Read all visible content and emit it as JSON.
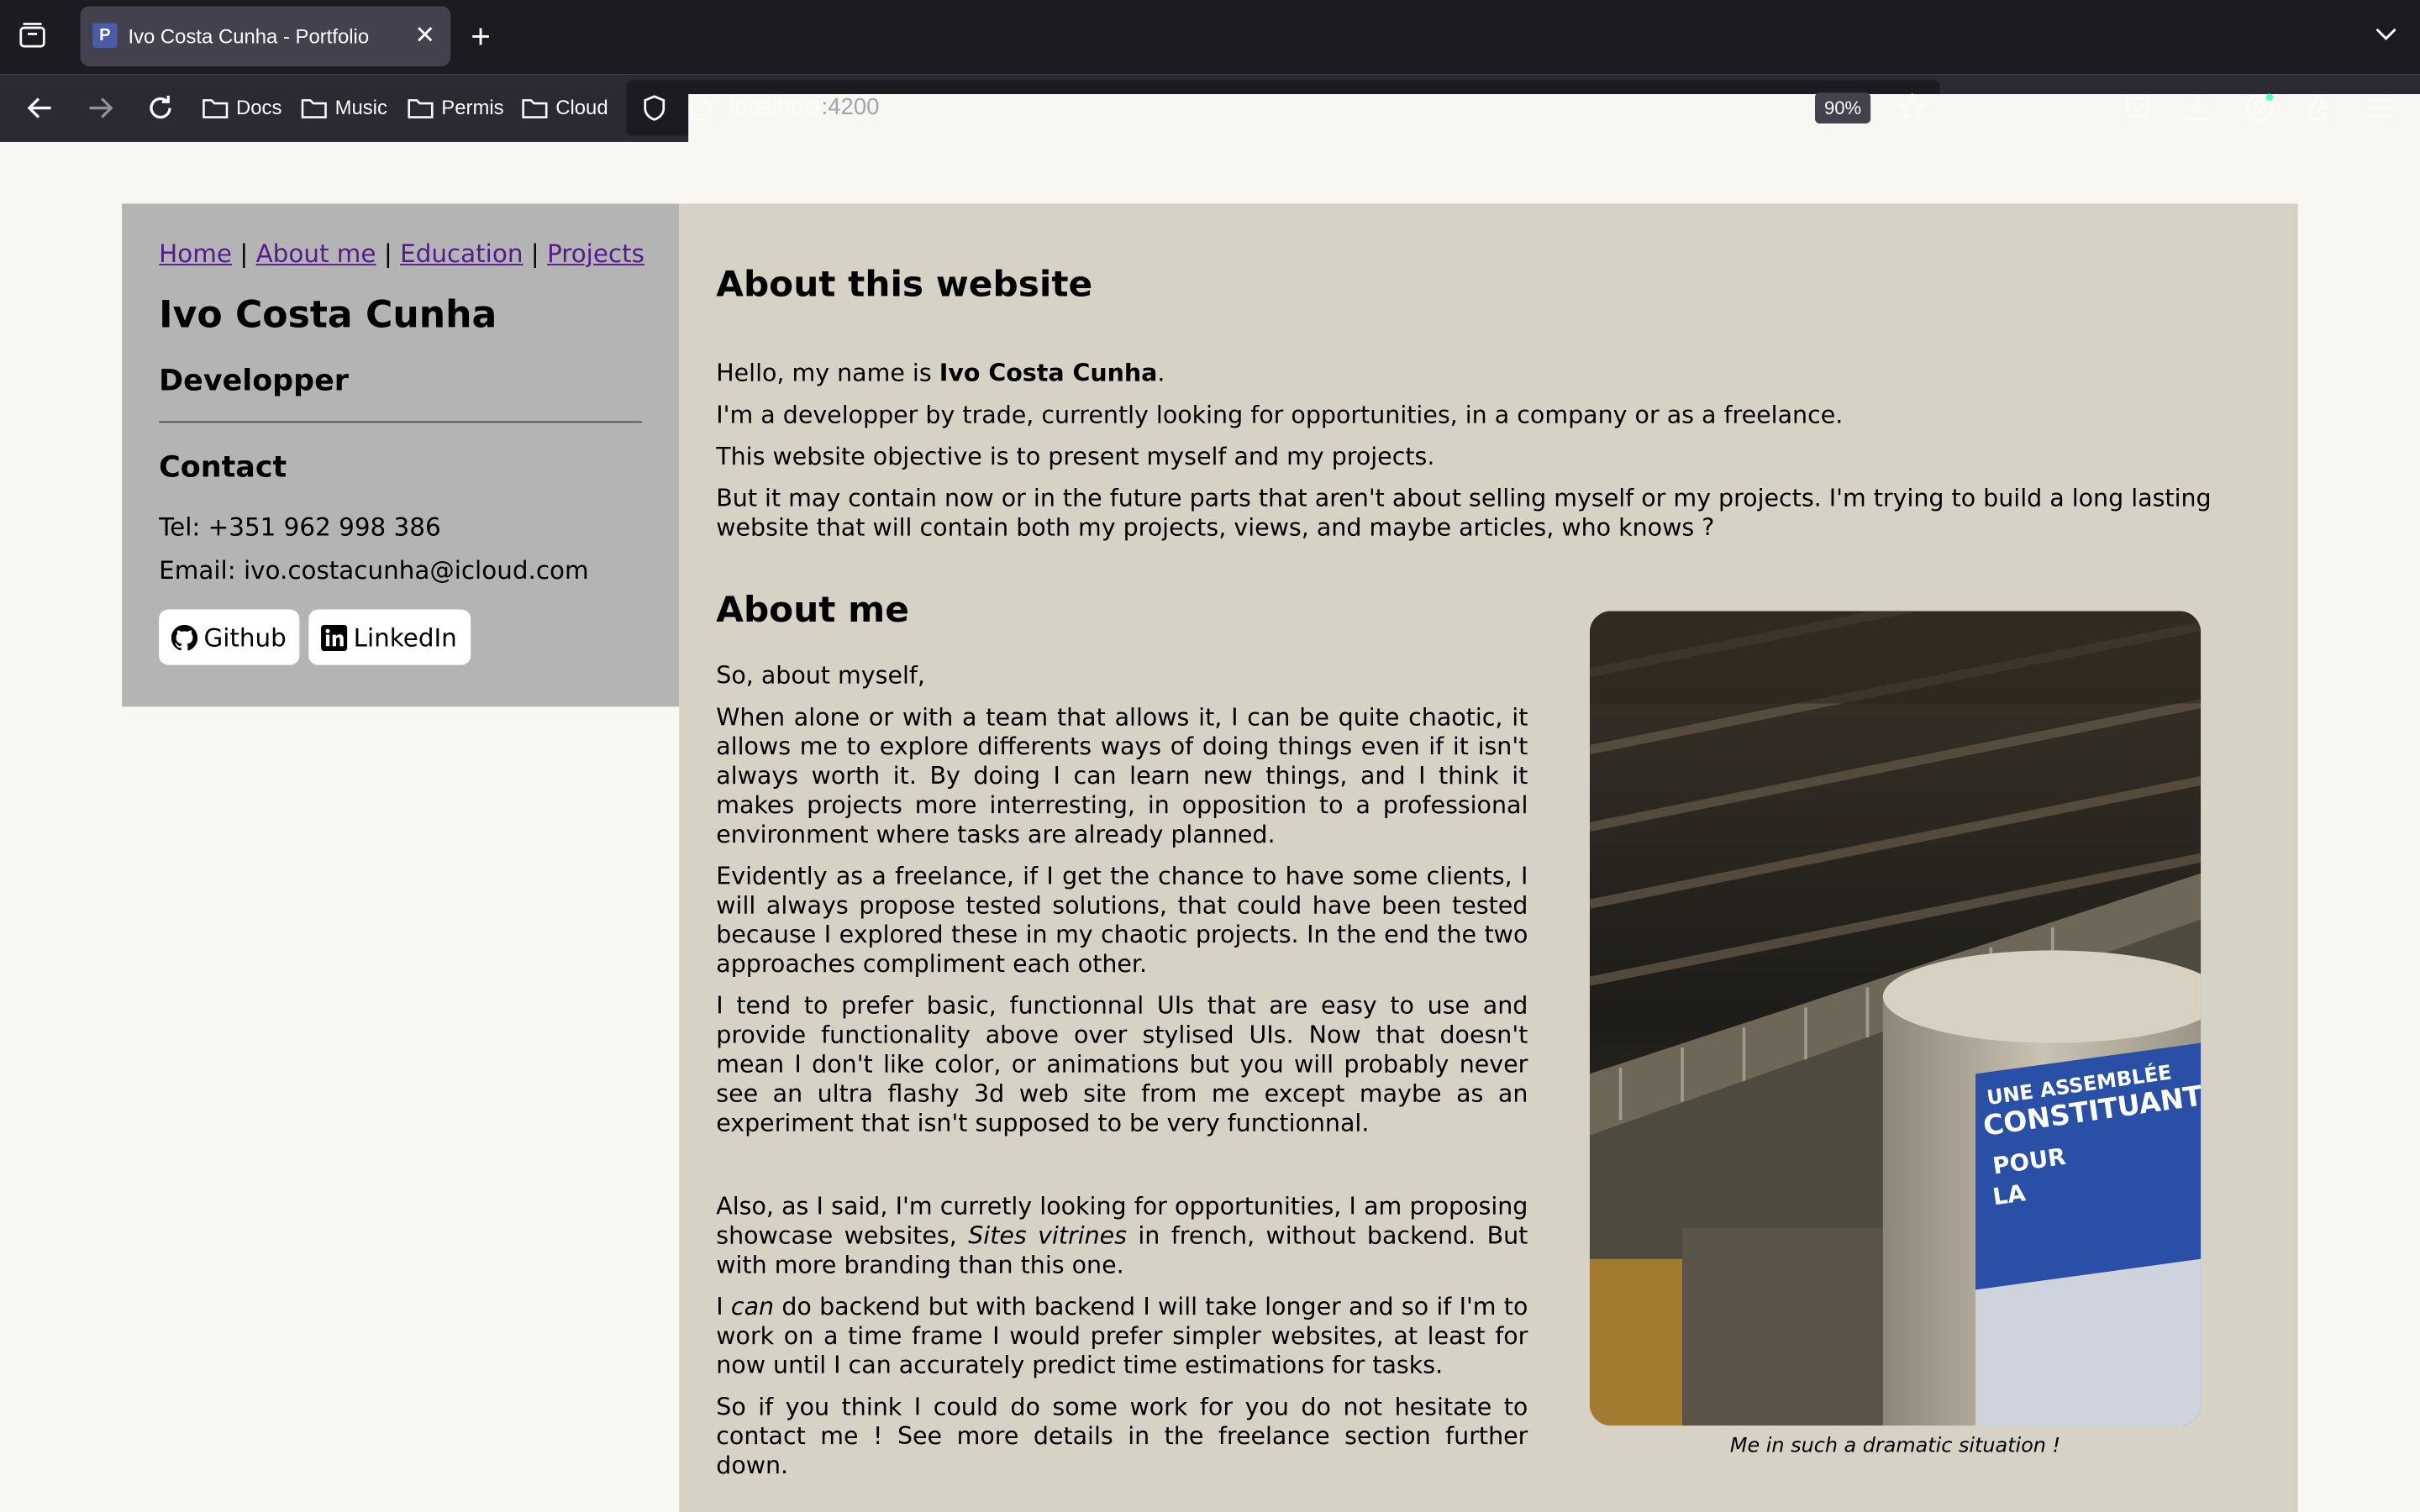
{
  "browser": {
    "tab_title": "Ivo Costa Cunha - Portfolio",
    "tab_favicon": "P",
    "bookmarks": [
      "Docs",
      "Music",
      "Permis",
      "Cloud"
    ],
    "url_host": "localhost",
    "url_port": ":4200",
    "zoom": "90%"
  },
  "sidebar": {
    "nav": [
      "Home",
      "About me",
      "Education",
      "Projects"
    ],
    "separator": "|",
    "name": "Ivo Costa Cunha",
    "role": "Developper",
    "contact_heading": "Contact",
    "tel": "Tel: +351 962 998 386",
    "email": "Email: ivo.costacunha@icloud.com",
    "github": "Github",
    "linkedin": "LinkedIn"
  },
  "about_site": {
    "heading": "About this website",
    "hello_prefix": "Hello, my name is ",
    "hello_name": "Ivo Costa Cunha",
    "hello_suffix": ".",
    "p2": "I'm a developper by trade, currently looking for opportunities, in a company or as a freelance.",
    "p3": "This website objective is to present myself and my projects.",
    "p4": "But it may contain now or in the future parts that aren't about selling myself or my projects. I'm trying to build a long lasting website that will contain both my projects, views, and maybe articles, who knows ?"
  },
  "about_me": {
    "heading": "About me",
    "p1": "So, about myself,",
    "p2": "When alone or with a team that allows it, I can be quite chaotic, it allows me to explore differents ways of doing things even if it isn't always worth it. By doing I can learn new things, and I think it makes projects more interresting, in opposition to a professional environment where tasks are already planned.",
    "p3": "Evidently as a freelance, if I get the chance to have some clients, I will always propose tested solutions, that could have been tested because I explored these in my chaotic projects. In the end the two approaches compliment each other.",
    "p4": "I tend to prefer basic, functionnal UIs that are easy to use and provide functionality above over stylised UIs. Now that doesn't mean I don't like color, or animations but you will probably never see an ultra flashy 3d web site from me except maybe as an experiment that isn't supposed to be very functionnal.",
    "p5_a": "Also, as I said, I'm curretly looking for opportunities, I am proposing showcase websites, ",
    "p5_em": "Sites vitrines",
    "p5_b": " in french, without backend. But with more branding than this one.",
    "p6_a": "I ",
    "p6_em": "can",
    "p6_b": " do backend but with backend I will take longer and so if I'm to work on a time frame I would prefer simpler websites, at least for now until I can accurately predict time estimations for tasks.",
    "p7": "So if you think I could do some work for you do not hesitate to contact me ! See more details in the freelance section further down.",
    "photo_text_1": "UNE ASSEMBLÉE",
    "photo_text_2": "CONSTITUANTE",
    "photo_text_3": "POUR",
    "photo_text_4": "LA",
    "caption": "Me in such a dramatic situation !"
  }
}
